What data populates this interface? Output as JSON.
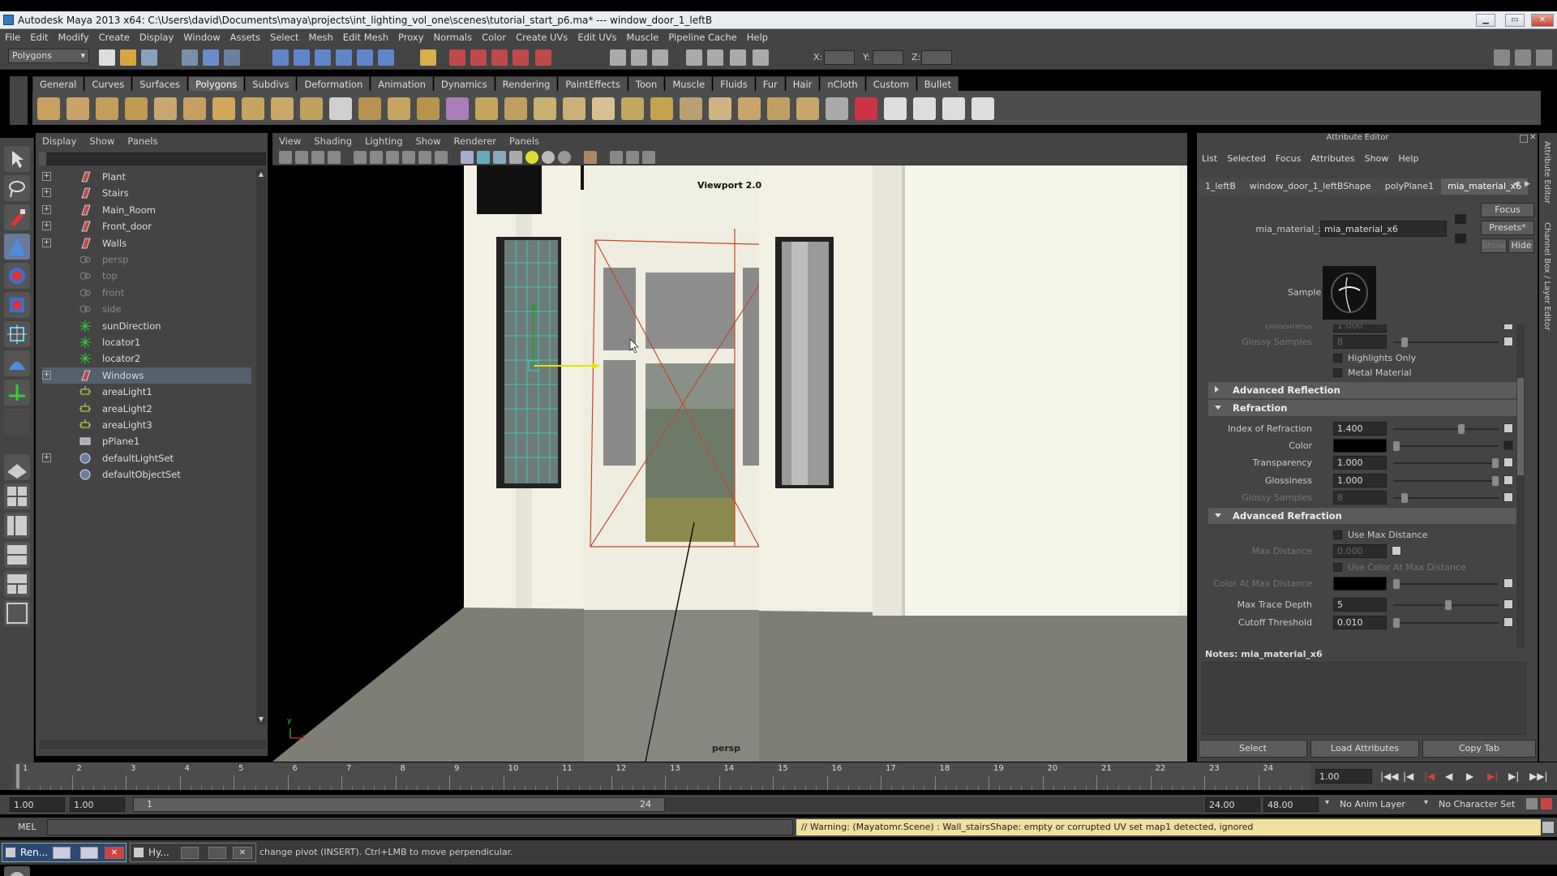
{
  "window": {
    "title": "Autodesk Maya 2013 x64: C:\\Users\\david\\Documents\\maya\\projects\\int_lighting_vol_one\\scenes\\tutorial_start_p6.ma*   ---   window_door_1_leftB"
  },
  "menubar": [
    "File",
    "Edit",
    "Modify",
    "Create",
    "Display",
    "Window",
    "Assets",
    "Select",
    "Mesh",
    "Edit Mesh",
    "Proxy",
    "Normals",
    "Color",
    "Create UVs",
    "Edit UVs",
    "Muscle",
    "Pipeline Cache",
    "Help"
  ],
  "statusline": {
    "mode": "Polygons",
    "x_label": "X:",
    "y_label": "Y:",
    "z_label": "Z:"
  },
  "shelf_tabs": [
    "General",
    "Curves",
    "Surfaces",
    "Polygons",
    "Subdivs",
    "Deformation",
    "Animation",
    "Dynamics",
    "Rendering",
    "PaintEffects",
    "Toon",
    "Muscle",
    "Fluids",
    "Fur",
    "Hair",
    "nCloth",
    "Custom",
    "Bullet"
  ],
  "shelf_active": "Polygons",
  "outliner": {
    "menu": [
      "Display",
      "Show",
      "Panels"
    ],
    "items": [
      {
        "label": "Plant",
        "icon": "transform-icon",
        "expandable": true,
        "dim": false,
        "selected": false
      },
      {
        "label": "Stairs",
        "icon": "transform-icon",
        "expandable": true,
        "dim": false,
        "selected": false
      },
      {
        "label": "Main_Room",
        "icon": "transform-icon",
        "expandable": true,
        "dim": false,
        "selected": false
      },
      {
        "label": "Front_door",
        "icon": "transform-icon",
        "expandable": true,
        "dim": false,
        "selected": false
      },
      {
        "label": "Walls",
        "icon": "transform-icon",
        "expandable": true,
        "dim": false,
        "selected": false
      },
      {
        "label": "persp",
        "icon": "camera-icon",
        "expandable": false,
        "dim": true,
        "selected": false
      },
      {
        "label": "top",
        "icon": "camera-icon",
        "expandable": false,
        "dim": true,
        "selected": false
      },
      {
        "label": "front",
        "icon": "camera-icon",
        "expandable": false,
        "dim": true,
        "selected": false
      },
      {
        "label": "side",
        "icon": "camera-icon",
        "expandable": false,
        "dim": true,
        "selected": false
      },
      {
        "label": "sunDirection",
        "icon": "light-icon",
        "expandable": false,
        "dim": false,
        "selected": false
      },
      {
        "label": "locator1",
        "icon": "locator-icon",
        "expandable": false,
        "dim": false,
        "selected": false
      },
      {
        "label": "locator2",
        "icon": "locator-icon",
        "expandable": false,
        "dim": false,
        "selected": false
      },
      {
        "label": "Windows",
        "icon": "transform-icon",
        "expandable": true,
        "dim": false,
        "selected": true
      },
      {
        "label": "areaLight1",
        "icon": "area-light-icon",
        "expandable": false,
        "dim": false,
        "selected": false
      },
      {
        "label": "areaLight2",
        "icon": "area-light-icon",
        "expandable": false,
        "dim": false,
        "selected": false
      },
      {
        "label": "areaLight3",
        "icon": "area-light-icon",
        "expandable": false,
        "dim": false,
        "selected": false
      },
      {
        "label": "pPlane1",
        "icon": "mesh-icon",
        "expandable": false,
        "dim": false,
        "selected": false
      },
      {
        "label": "defaultLightSet",
        "icon": "set-icon",
        "expandable": true,
        "dim": false,
        "selected": false
      },
      {
        "label": "defaultObjectSet",
        "icon": "set-icon",
        "expandable": false,
        "dim": false,
        "selected": false
      }
    ]
  },
  "viewport": {
    "menu": [
      "View",
      "Shading",
      "Lighting",
      "Show",
      "Renderer",
      "Panels"
    ],
    "renderer_label": "Viewport 2.0",
    "camera_label": "persp",
    "axis_y": "y",
    "axis_x": "x"
  },
  "attribute_editor": {
    "title": "Attribute Editor",
    "menu": [
      "List",
      "Selected",
      "Focus",
      "Attributes",
      "Show",
      "Help"
    ],
    "tabs": [
      "1_leftB",
      "window_door_1_leftBShape",
      "polyPlane1",
      "mia_material_x6"
    ],
    "active_tab": "mia_material_x6",
    "node_label": "mia_material_x:",
    "node_value": "mia_material_x6",
    "focus_btn": "Focus",
    "presets_btn": "Presets*",
    "show_btn": "Show",
    "hide_btn": "Hide",
    "sample_label": "Sample",
    "rows_top": {
      "glossiness_cut": "Glossiness",
      "glossiness_cut_val": "1.000",
      "glossy_samples": "Glossy Samples",
      "glossy_samples_val": "8",
      "highlights_only": "Highlights Only",
      "metal_material": "Metal Material"
    },
    "sect_adv_reflection": "Advanced Reflection",
    "sect_refraction": "Refraction",
    "refraction": {
      "ior_label": "Index of Refraction",
      "ior_val": "1.400",
      "color_label": "Color",
      "transparency_label": "Transparency",
      "transparency_val": "1.000",
      "glossiness_label": "Glossiness",
      "glossiness_val": "1.000",
      "glossy_samples_label": "Glossy Samples",
      "glossy_samples_val": "8"
    },
    "sect_adv_refraction": "Advanced Refraction",
    "adv_refraction": {
      "use_max_distance": "Use Max Distance",
      "max_distance_label": "Max Distance",
      "max_distance_val": "0.000",
      "use_color_at_max": "Use Color At Max Distance",
      "color_at_max_label": "Color At Max Distance",
      "max_trace_depth_label": "Max Trace Depth",
      "max_trace_depth_val": "5",
      "cutoff_threshold_label": "Cutoff Threshold",
      "cutoff_threshold_val": "0.010"
    },
    "notes_label": "Notes:  mia_material_x6",
    "select_btn": "Select",
    "load_attributes_btn": "Load Attributes",
    "copy_tab_btn": "Copy Tab",
    "side_tabs": [
      "Attribute Editor",
      "Channel Box / Layer Editor"
    ]
  },
  "timeline": {
    "ticks": [
      "1",
      "2",
      "3",
      "4",
      "5",
      "6",
      "7",
      "8",
      "9",
      "10",
      "11",
      "12",
      "13",
      "14",
      "15",
      "16",
      "17",
      "18",
      "19",
      "20",
      "21",
      "22",
      "23",
      "24"
    ],
    "current_frame": "1.00"
  },
  "range": {
    "start": "1.00",
    "playback_start": "1.00",
    "range_start_label": "1",
    "range_end_label": "24",
    "playback_end": "24.00",
    "end": "48.00",
    "anim_layer": "No Anim Layer",
    "character_set": "No Character Set"
  },
  "command": {
    "lang": "MEL",
    "warning": "// Warning: (Mayatomr.Scene) : Wall_stairsShape: empty or corrupted UV set map1 detected, ignored"
  },
  "help": {
    "text": "change pivot (INSERT). Ctrl+LMB to move perpendicular.",
    "task1": "Ren...",
    "task2": "Hy..."
  },
  "colors": {
    "panel": "#444444",
    "accent_selected": "#54606e",
    "warning_bg": "#efe0a0",
    "viewport_wall": "#efefe2"
  }
}
